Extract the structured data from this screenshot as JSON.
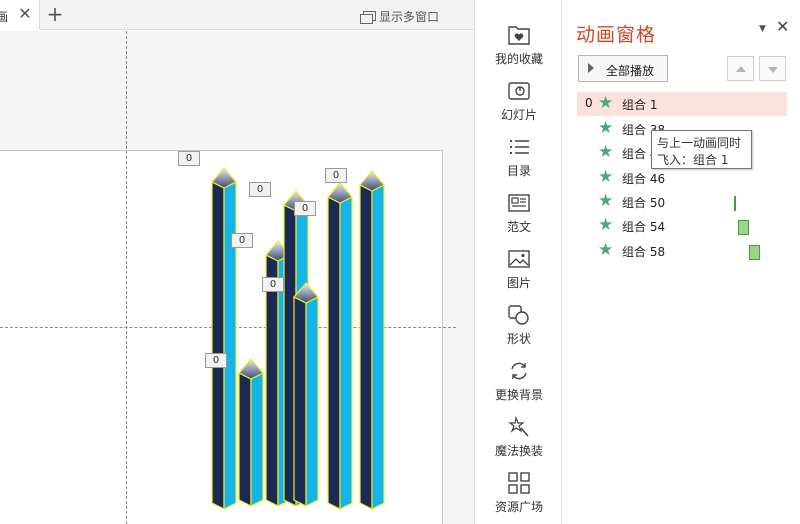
{
  "tabbar": {
    "active_tab_label": "动画",
    "close_glyph": "✕",
    "add_glyph": "+",
    "multi_window_label": "显示多窗口"
  },
  "canvas": {
    "animation_tags": [
      "0",
      "0",
      "0",
      "0",
      "0",
      "0",
      "0"
    ]
  },
  "toolbar": {
    "items": [
      {
        "label": "我的收藏",
        "icon": "favorite-folder-icon"
      },
      {
        "label": "幻灯片",
        "icon": "slides-icon"
      },
      {
        "label": "目录",
        "icon": "catalog-icon"
      },
      {
        "label": "范文",
        "icon": "template-icon"
      },
      {
        "label": "图片",
        "icon": "picture-icon"
      },
      {
        "label": "形状",
        "icon": "shape-icon"
      },
      {
        "label": "更换背景",
        "icon": "change-background-icon"
      },
      {
        "label": "魔法换装",
        "icon": "magic-wand-icon"
      },
      {
        "label": "资源广场",
        "icon": "resource-grid-icon"
      }
    ]
  },
  "pane": {
    "title": "动画窗格",
    "menu_glyph": "▼",
    "close_glyph": "✕",
    "play_all_label": "全部播放",
    "items": [
      {
        "num": "0",
        "name": "组合 1",
        "selected": true
      },
      {
        "num": "",
        "name": "组合 38",
        "selected": false
      },
      {
        "num": "",
        "name": "组合 42",
        "selected": false
      },
      {
        "num": "",
        "name": "组合 46",
        "selected": false
      },
      {
        "num": "",
        "name": "组合 50",
        "selected": false
      },
      {
        "num": "",
        "name": "组合 54",
        "selected": false
      },
      {
        "num": "",
        "name": "组合 58",
        "selected": false
      }
    ],
    "star_glyph": "★",
    "tooltip": {
      "line1": "与上一动画同时",
      "line2": "飞入：组合 1"
    }
  },
  "colors": {
    "pane_title": "#d24726",
    "star": "#4aaa7d",
    "selected_row": "#fbe2dc",
    "pillar_front": "#1a2a55",
    "pillar_side": "#16b3ea",
    "pillar_outline": "#f2ef21",
    "timing_bar": "#9ad58d"
  }
}
